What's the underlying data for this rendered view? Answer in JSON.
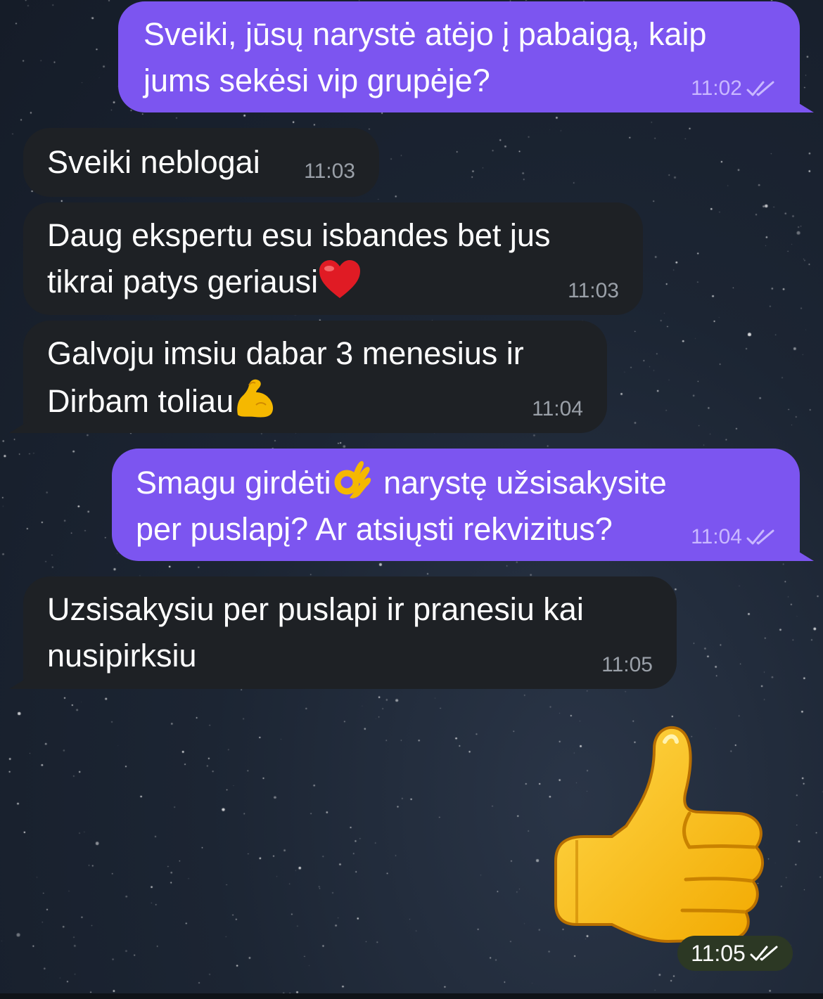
{
  "messages": [
    {
      "id": "m1",
      "direction": "outgoing",
      "text": "Sveiki, jūsų narystė atėjo į pabaigą, kaip\njums sekėsi vip grupėje?",
      "time": "11:02",
      "status": "read"
    },
    {
      "id": "m2",
      "direction": "incoming",
      "text": "Sveiki neblogai",
      "time": "11:03"
    },
    {
      "id": "m3",
      "direction": "incoming",
      "text_line1": "Daug ekspertu esu isbandes bet jus",
      "text_line2": "tikrai patys geriausi",
      "emoji": "red-heart",
      "time": "11:03"
    },
    {
      "id": "m4",
      "direction": "incoming",
      "text_line1": "Galvoju imsiu dabar 3 menesius ir",
      "text_line2": "Dirbam toliau",
      "emoji": "flexed-biceps",
      "time": "11:04"
    },
    {
      "id": "m5",
      "direction": "outgoing",
      "text_part1": "Smagu girdėti",
      "emoji": "ok-hand",
      "text_part2": " narystę užsisakysite",
      "text_line2": "per puslapį? Ar atsiųsti rekvizitus?",
      "time": "11:04",
      "status": "read"
    },
    {
      "id": "m6",
      "direction": "incoming",
      "text": "Uzsisakysiu per puslapi ir pranesiu kai\nnusipirksiu",
      "time": "11:05"
    },
    {
      "id": "m7",
      "direction": "outgoing",
      "sticker": "thumbs-up",
      "time": "11:05",
      "status": "read"
    }
  ],
  "colors": {
    "outgoing_bubble": "#7c55f0",
    "incoming_bubble": "#1e2125",
    "background": "#1c2533"
  }
}
